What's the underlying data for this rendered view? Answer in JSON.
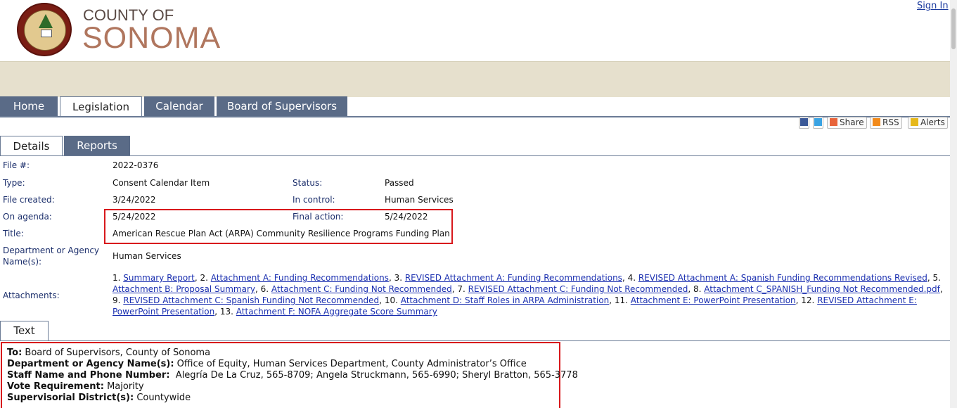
{
  "header": {
    "county_of": "COUNTY OF",
    "sonoma": "SONOMA",
    "sign_in": "Sign In"
  },
  "nav": [
    "Home",
    "Legislation",
    "Calendar",
    "Board of Supervisors"
  ],
  "social": {
    "share": "Share",
    "rss": "RSS",
    "alerts": "Alerts"
  },
  "subtabs": [
    "Details",
    "Reports"
  ],
  "details": {
    "file_no_label": "File #:",
    "file_no": "2022-0376",
    "type_label": "Type:",
    "type": "Consent Calendar Item",
    "status_label": "Status:",
    "status": "Passed",
    "file_created_label": "File created:",
    "file_created": "3/24/2022",
    "in_control_label": "In control:",
    "in_control": "Human Services",
    "on_agenda_label": "On agenda:",
    "on_agenda": "5/24/2022",
    "final_action_label": "Final action:",
    "final_action": "5/24/2022",
    "title_label": "Title:",
    "title": "American Rescue Plan Act (ARPA) Community Resilience Programs Funding Plan",
    "dept_label_1": "Department or Agency",
    "dept_label_2": "Name(s):",
    "dept": "Human Services",
    "attachments_label": "Attachments:"
  },
  "attachments": [
    "Summary Report",
    "Attachment A: Funding Recommendations",
    "REVISED Attachment A: Funding Recommendations",
    "REVISED Attachment A: Spanish Funding Recommendations Revised",
    "Attachment B: Proposal Summary",
    "Attachment C: Funding Not Recommended",
    "REVISED Attachment C: Funding Not Recommended",
    "Attachment C_SPANISH_Funding Not Recommended.pdf",
    "REVISED Attachment C: Spanish Funding Not Recommended",
    "Attachment D: Staff Roles in ARPA Administration",
    "Attachment E: PowerPoint Presentation",
    "REVISED Attachment E: PowerPoint Presentation",
    "Attachment F: NOFA Aggregate Score Summary"
  ],
  "text_tab": "Text",
  "text_body": {
    "to_label": "To:",
    "to": "Board of Supervisors, County of Sonoma",
    "dept_label": "Department or Agency Name(s):",
    "dept": "Office of Equity, Human Services Department, County Administrator’s Office",
    "staff_label": "Staff Name and Phone Number:",
    "staff": "Alegría De La Cruz, 565-8709; Angela Struckmann, 565-6990; Sheryl Bratton, 565-3778",
    "vote_label": "Vote Requirement:",
    "vote": "Majority",
    "district_label": "Supervisorial District(s):",
    "district": "Countywide"
  }
}
